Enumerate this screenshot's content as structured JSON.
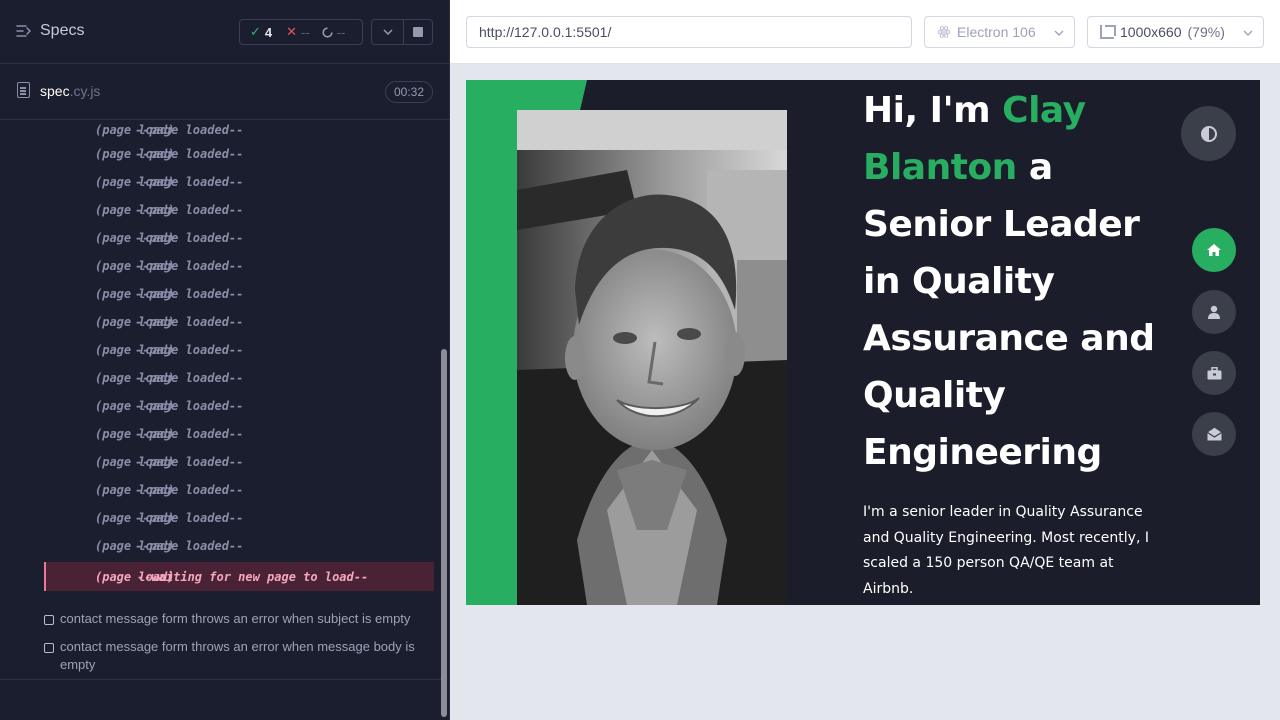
{
  "reporter": {
    "specs_label": "Specs",
    "stats": {
      "passed": "4",
      "failed": "--",
      "pending": "--"
    },
    "spec_file": {
      "name": "spec",
      "ext": ".cy.js"
    },
    "duration": "00:32",
    "commands": [
      {
        "name": "(page load)",
        "message": "--page loaded--"
      },
      {
        "name": "(page load)",
        "message": "--page loaded--"
      },
      {
        "name": "(page load)",
        "message": "--page loaded--"
      },
      {
        "name": "(page load)",
        "message": "--page loaded--"
      },
      {
        "name": "(page load)",
        "message": "--page loaded--"
      },
      {
        "name": "(page load)",
        "message": "--page loaded--"
      },
      {
        "name": "(page load)",
        "message": "--page loaded--"
      },
      {
        "name": "(page load)",
        "message": "--page loaded--"
      },
      {
        "name": "(page load)",
        "message": "--page loaded--"
      },
      {
        "name": "(page load)",
        "message": "--page loaded--"
      },
      {
        "name": "(page load)",
        "message": "--page loaded--"
      },
      {
        "name": "(page load)",
        "message": "--page loaded--"
      },
      {
        "name": "(page load)",
        "message": "--page loaded--"
      },
      {
        "name": "(page load)",
        "message": "--page loaded--"
      },
      {
        "name": "(page load)",
        "message": "--page loaded--"
      },
      {
        "name": "(page load)",
        "message": "--page loaded--"
      }
    ],
    "active_command": {
      "name": "(page load)",
      "message": "--waiting for new page to load--"
    },
    "tests": [
      "contact message form throws an error when subject is empty",
      "contact message form throws an error when message body is empty"
    ]
  },
  "browser_bar": {
    "url": "http://127.0.0.1:5501/",
    "browser": "Electron 106",
    "viewport": "1000x660",
    "zoom": "(79%)"
  },
  "site": {
    "hero": {
      "pre": "Hi, I'm",
      "name_first": "Clay",
      "name_last": "Blanton",
      "post": "a Senior Leader in Quality Assurance and Quality Engineering"
    },
    "bio": "I'm a senior leader in Quality Assurance and Quality Engineering. Most recently, I scaled a 150 person QA/QE team at Airbnb.",
    "nav": [
      {
        "icon": "home-icon"
      },
      {
        "icon": "user-icon"
      },
      {
        "icon": "briefcase-icon"
      },
      {
        "icon": "envelope-open-icon"
      }
    ]
  },
  "colors": {
    "accent": "#27ae60",
    "reporter_bg": "#1b1e2e",
    "site_bg": "#1b1d2b",
    "active_cmd_bg": "#4a2236"
  }
}
